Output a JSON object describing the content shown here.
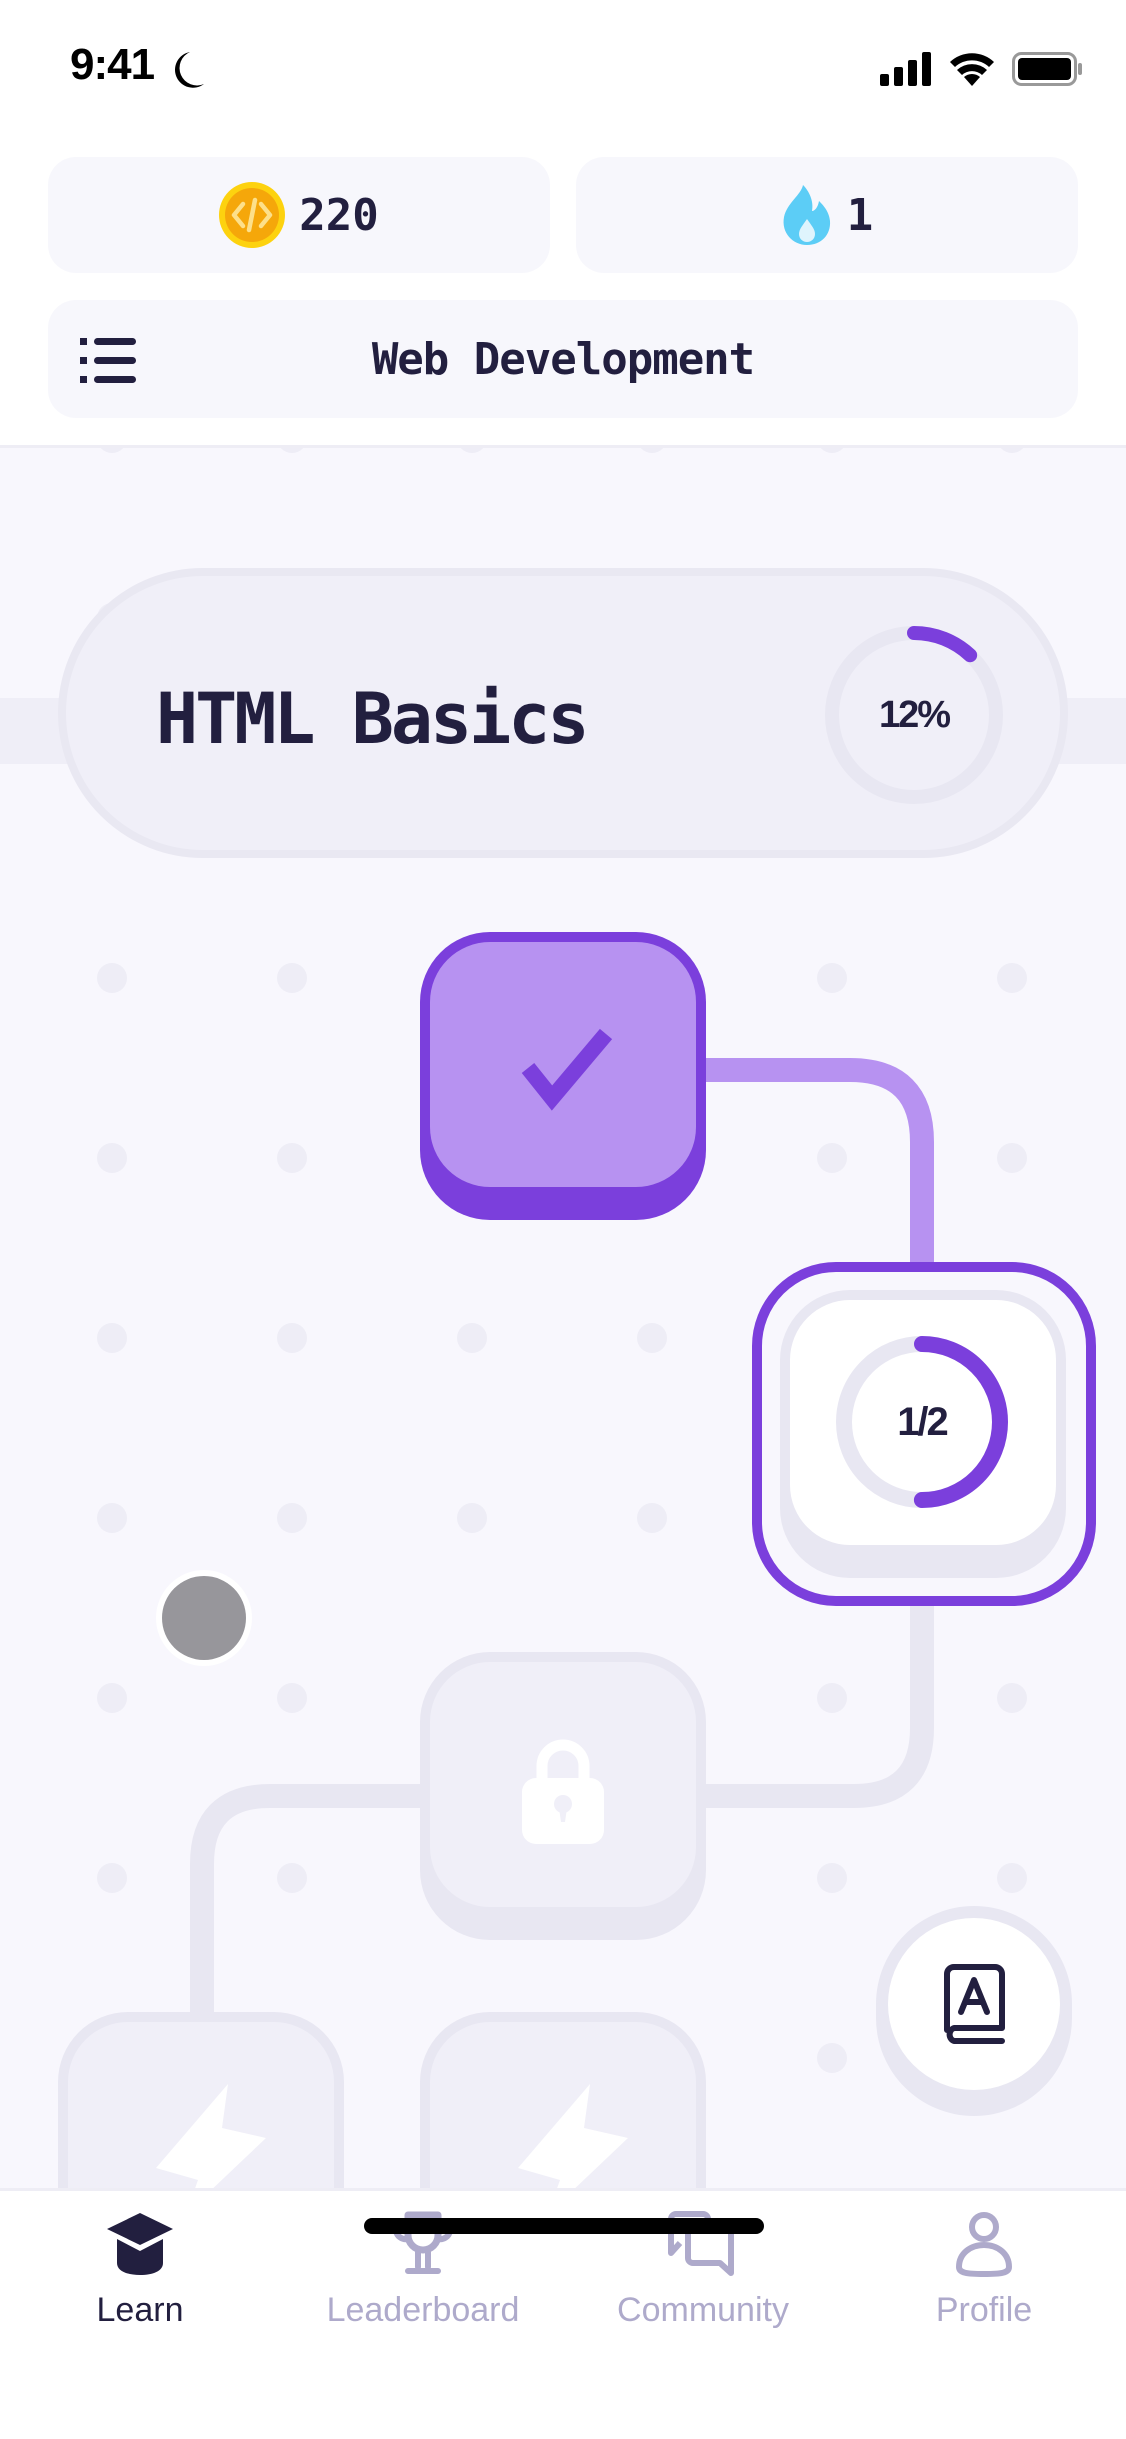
{
  "status_bar": {
    "time": "9:41",
    "icons": [
      "moon-icon",
      "cellular-signal-icon",
      "wifi-icon",
      "battery-icon"
    ]
  },
  "header": {
    "coins": {
      "icon": "code-coin-icon",
      "value": "220"
    },
    "streak": {
      "icon": "flame-icon",
      "value": "1"
    },
    "course": {
      "menu_icon": "list-icon",
      "title": "Web Development"
    }
  },
  "map": {
    "unit": {
      "title": "HTML Basics",
      "progress_label": "12%",
      "progress": 0.12
    },
    "nodes": [
      {
        "state": "completed",
        "icon": "checkmark-icon"
      },
      {
        "state": "current",
        "progress_label": "1/2",
        "progress": 0.5
      },
      {
        "state": "locked",
        "icon": "lock-icon"
      },
      {
        "state": "locked",
        "icon": "lightning-icon"
      },
      {
        "state": "locked",
        "icon": "lightning-icon"
      }
    ],
    "glossary_button": {
      "icon": "book-a-icon"
    }
  },
  "colors": {
    "accent": "#7b3fdc",
    "accent_light": "#b792f1",
    "text_dark": "#221f3f",
    "inactive": "#aeaacb",
    "coin": "#f5a70a",
    "flame": "#5ccdf6"
  },
  "tabbar": {
    "tabs": [
      {
        "label": "Learn",
        "icon": "graduation-cap-icon",
        "active": true
      },
      {
        "label": "Leaderboard",
        "icon": "trophy-icon",
        "active": false
      },
      {
        "label": "Community",
        "icon": "chat-bubbles-icon",
        "active": false
      },
      {
        "label": "Profile",
        "icon": "person-icon",
        "active": false
      }
    ]
  }
}
